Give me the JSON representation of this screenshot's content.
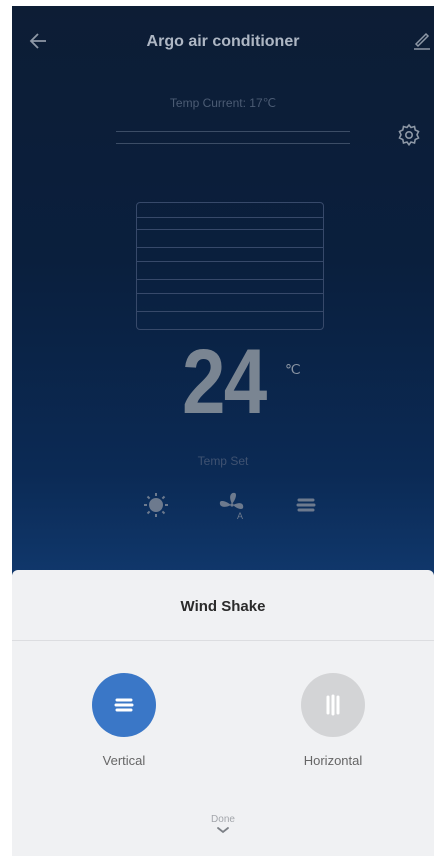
{
  "header": {
    "title": "Argo air conditioner"
  },
  "status": {
    "temp_current": "Temp Current:  17℃"
  },
  "temperature": {
    "value": "24",
    "unit": "℃",
    "label": "Temp Set"
  },
  "icons": {
    "back": "arrow-left-icon",
    "edit": "edit-pencil-icon",
    "settings": "gear-icon",
    "mode_heat": "sun-icon",
    "mode_fan": "fan-auto-icon",
    "mode_swing": "swing-lines-icon",
    "done": "chevron-down-icon"
  },
  "sheet": {
    "title": "Wind Shake",
    "options": [
      {
        "label": "Vertical",
        "selected": true
      },
      {
        "label": "Horizontal",
        "selected": false
      }
    ],
    "done_label": "Done"
  },
  "colors": {
    "accent": "#3a77c7",
    "inactive": "#d3d4d6",
    "sheet_bg": "#f0f1f3"
  }
}
